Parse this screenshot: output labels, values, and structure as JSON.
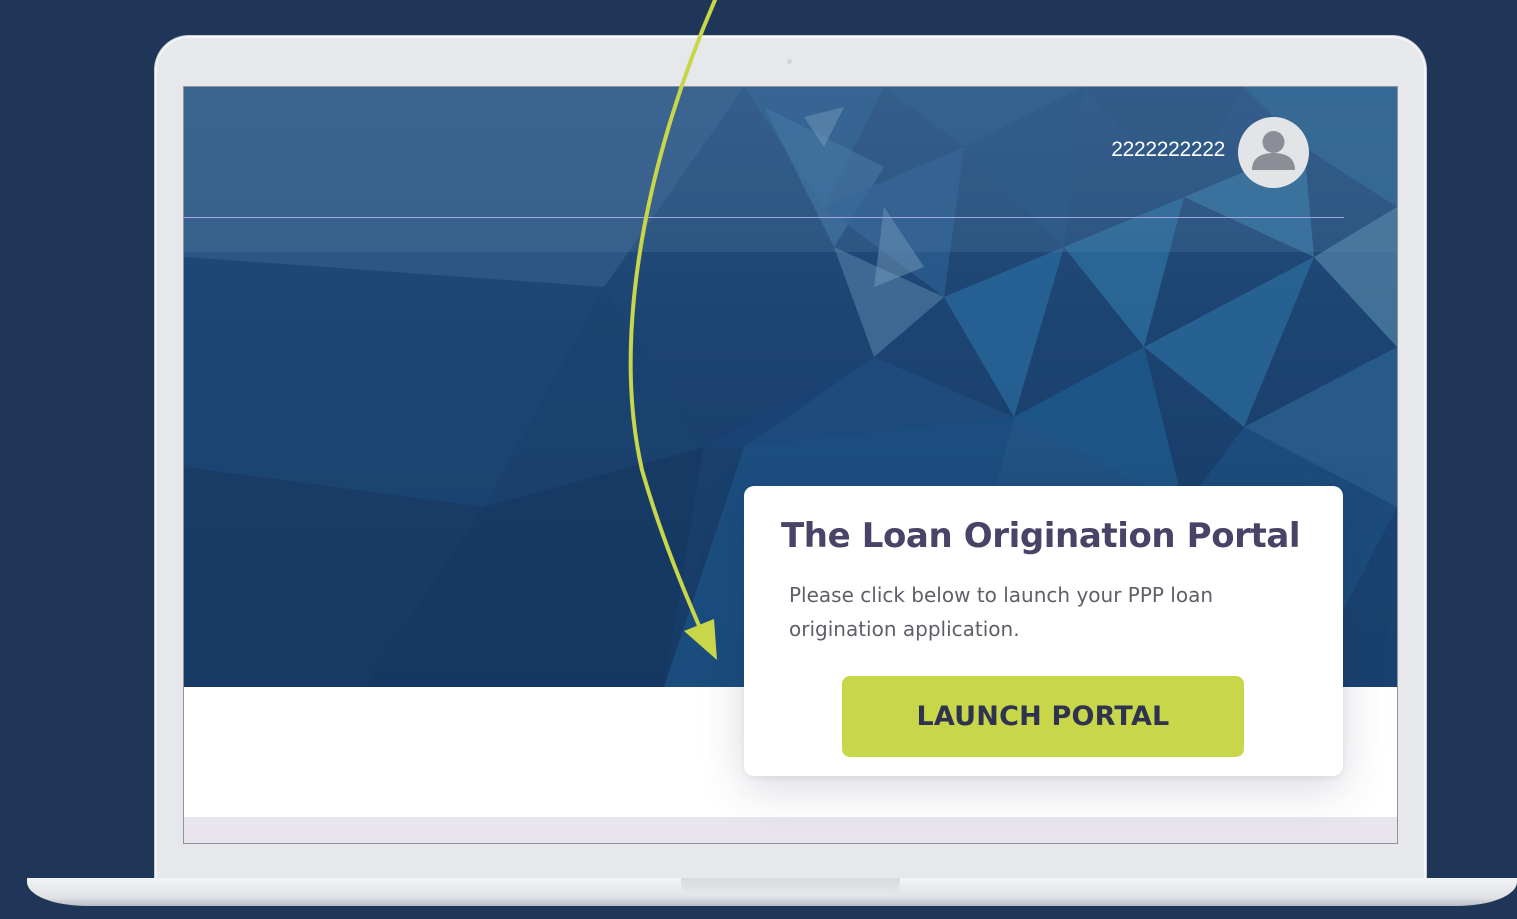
{
  "header": {
    "user_id": "2222222222"
  },
  "card": {
    "title": "The Loan Origination Portal",
    "description": "Please click below to launch your PPP loan origination application.",
    "button_label": "LAUNCH PORTAL"
  },
  "icons": {
    "avatar": "user-avatar-icon",
    "arrow": "curved-arrow-annotation"
  },
  "colors": {
    "background": "#1f3658",
    "hero_dark": "#163a64",
    "accent_button": "#c8d64a",
    "title_text": "#474467",
    "arrow": "#c8d64a"
  }
}
